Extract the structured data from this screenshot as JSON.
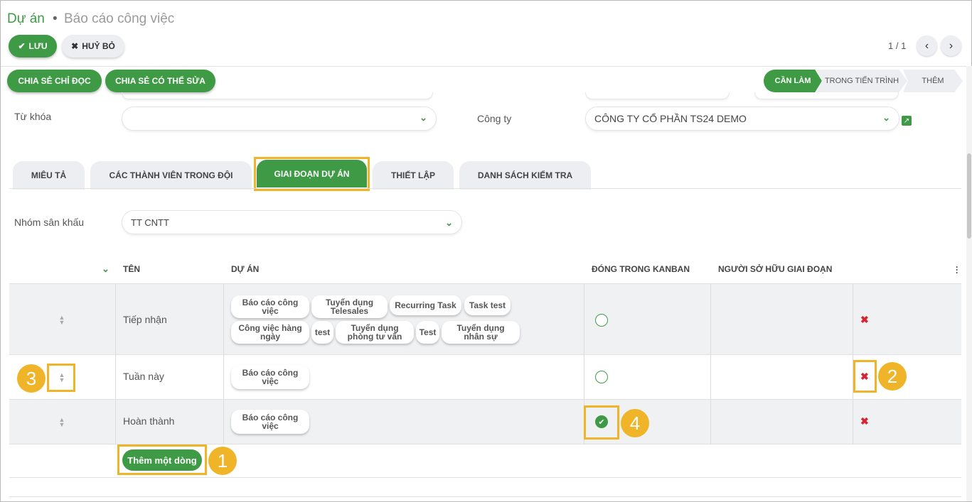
{
  "breadcrumb": {
    "root": "Dự án",
    "separator": "•",
    "current": "Báo cáo công việc"
  },
  "toolbar": {
    "save_label": "LƯU",
    "cancel_label": "HUỶ BỎ",
    "pager": "1 / 1"
  },
  "share": {
    "read_only": "CHIA SẺ CHỈ ĐỌC",
    "editable": "CHIA SẺ CÓ THỂ SỬA"
  },
  "stages": [
    "CẦN LÀM",
    "TRONG TIẾN TRÌNH",
    "THÊM"
  ],
  "form": {
    "keyword_label": "Từ khóa",
    "keyword_value": "",
    "company_label": "Công ty",
    "company_value": "CÔNG TY CỔ PHẦN TS24 DEMO",
    "stage_group_label": "Nhóm sân khấu",
    "stage_group_value": "TT CNTT"
  },
  "tabs": [
    "MIÊU TẢ",
    "CÁC THÀNH VIÊN TRONG ĐỘI",
    "GIAI ĐOẠN DỰ ÁN",
    "THIẾT LẬP",
    "DANH SÁCH KIỂM TRA"
  ],
  "table": {
    "headers": {
      "name": "TÊN",
      "project": "DỰ ÁN",
      "fold": "ĐÓNG TRONG KANBAN",
      "owner": "NGƯỜI SỞ HỮU GIAI ĐOẠN"
    },
    "rows": [
      {
        "name": "Tiếp nhận",
        "tags": [
          "Báo cáo công việc",
          "Tuyển dụng Telesales",
          "Recurring Task",
          "Task test",
          "Công việc hàng ngày",
          "test",
          "Tuyển dụng phòng tư vấn",
          "Test",
          "Tuyển dụng nhân sự"
        ],
        "folded": false
      },
      {
        "name": "Tuần này",
        "tags": [
          "Báo cáo công việc"
        ],
        "folded": false
      },
      {
        "name": "Hoàn thành",
        "tags": [
          "Báo cáo công việc"
        ],
        "folded": true
      }
    ],
    "add_line": "Thêm một dòng"
  },
  "annotations": [
    "1",
    "2",
    "3",
    "4"
  ],
  "colors": {
    "brand": "#3f9a46",
    "highlight": "#f0b429",
    "delete": "#d9232e"
  },
  "icons": {
    "save": "check-icon",
    "cancel": "x-icon",
    "prev": "chevron-left-icon",
    "next": "chevron-right-icon",
    "sort": "sort-icon",
    "delete": "delete-icon",
    "menu": "kebab-icon",
    "external": "external-link-icon"
  }
}
